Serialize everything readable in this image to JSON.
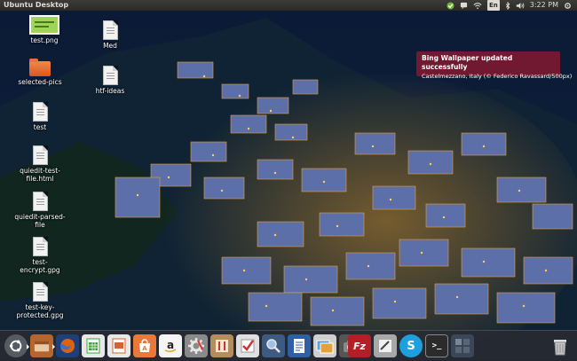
{
  "panel": {
    "title": "Ubuntu Desktop",
    "keyboard_layout": "En",
    "clock": "3:22 PM"
  },
  "desktop_icons": [
    {
      "label": "test.png",
      "kind": "image"
    },
    {
      "label": "selected-pics",
      "kind": "folder"
    },
    {
      "label": "test",
      "kind": "document"
    },
    {
      "label": "quiedit-test-file.html",
      "kind": "document"
    },
    {
      "label": "quiedit-parsed-file",
      "kind": "document"
    },
    {
      "label": "test-encrypt.gpg",
      "kind": "document"
    },
    {
      "label": "test-key-protected.gpg",
      "kind": "document"
    },
    {
      "label": "Med",
      "kind": "document"
    },
    {
      "label": "htf-ideas",
      "kind": "document"
    }
  ],
  "notification": {
    "title": "Bing Wallpaper updated successfully",
    "body": "Castelmezzano, Italy (© Federico Ravassard/500px)"
  },
  "dock": {
    "items": [
      {
        "name": "ubuntu-dash",
        "glyph": "",
        "color": "#e0e0e0"
      },
      {
        "name": "files",
        "glyph": "",
        "color": "#c9743a"
      },
      {
        "name": "firefox",
        "glyph": "",
        "color": "#e66000"
      },
      {
        "name": "libreoffice-calc",
        "glyph": "",
        "color": "#3fa33f"
      },
      {
        "name": "libreoffice-impress",
        "glyph": "",
        "color": "#d9622b"
      },
      {
        "name": "software-center",
        "glyph": "",
        "color": "#e8793a"
      },
      {
        "name": "amazon",
        "glyph": "a",
        "color": "#f0f0f0"
      },
      {
        "name": "system-settings",
        "glyph": "",
        "color": "#b8b8b8"
      },
      {
        "name": "text-editor",
        "glyph": "",
        "color": "#c8a070"
      },
      {
        "name": "tasks",
        "glyph": "",
        "color": "#d0d0d0"
      },
      {
        "name": "magnifier",
        "glyph": "",
        "color": "#6b8fb5"
      },
      {
        "name": "document-viewer",
        "glyph": "",
        "color": "#3a73c2"
      },
      {
        "name": "image-viewer",
        "glyph": "",
        "color": "#d8a040"
      },
      {
        "name": "screenshot",
        "glyph": "",
        "color": "#888888"
      },
      {
        "name": "filezilla",
        "glyph": "Fz",
        "color": "#c8202a"
      },
      {
        "name": "notes",
        "glyph": "",
        "color": "#c0c0c0"
      },
      {
        "name": "skype",
        "glyph": "S",
        "color": "#2aa8e0"
      },
      {
        "name": "terminal",
        "glyph": ">_",
        "color": "#333333"
      },
      {
        "name": "workspace-switcher",
        "glyph": "",
        "color": "#4a5a6a"
      },
      {
        "name": "trash",
        "glyph": "",
        "color": "#b0b0b0"
      }
    ]
  }
}
